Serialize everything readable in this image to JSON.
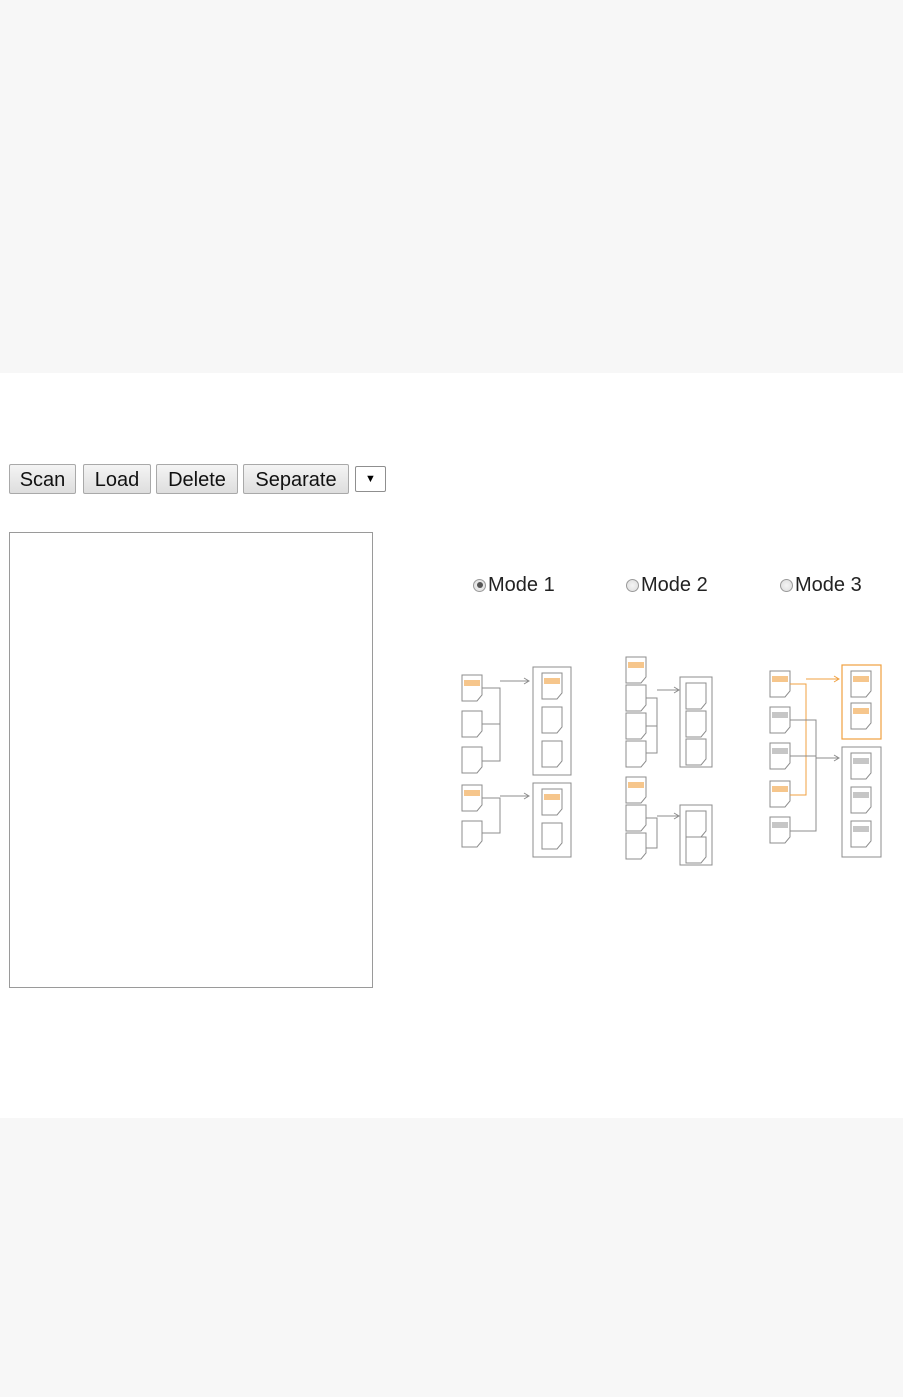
{
  "toolbar": {
    "scan_label": "Scan",
    "load_label": "Load",
    "delete_label": "Delete",
    "separate_label": "Separate",
    "dropdown_glyph": "▼"
  },
  "modes": [
    {
      "label": "Mode 1",
      "selected": true
    },
    {
      "label": "Mode 2",
      "selected": false
    },
    {
      "label": "Mode 3",
      "selected": false
    }
  ],
  "colors": {
    "accent": "#f0a040",
    "diagram_line": "#8c8c8c",
    "page_background": "#f7f7f7",
    "panel_background": "#ffffff"
  }
}
